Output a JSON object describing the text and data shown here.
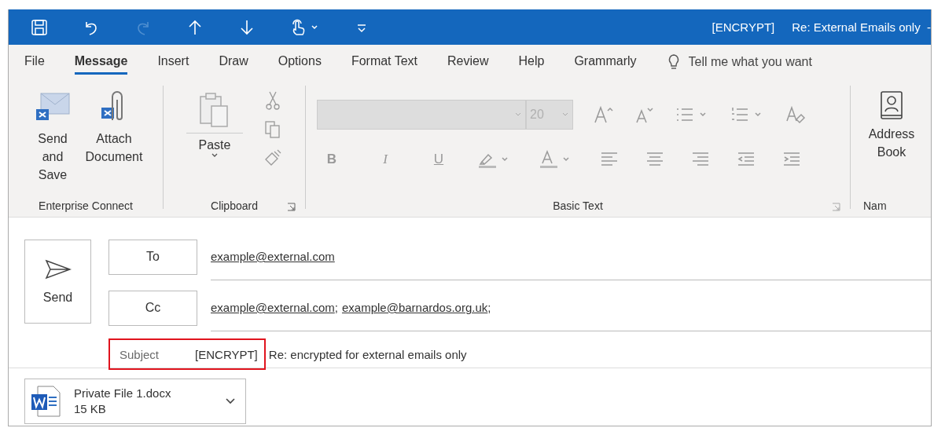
{
  "quick_access": [
    {
      "kind": "save",
      "disabled": false
    },
    {
      "kind": "undo",
      "disabled": false
    },
    {
      "kind": "redo",
      "disabled": true
    },
    {
      "kind": "up",
      "disabled": false
    },
    {
      "kind": "down",
      "disabled": false
    },
    {
      "kind": "touch",
      "disabled": false
    },
    {
      "kind": "customize",
      "disabled": false
    }
  ],
  "window": {
    "tag": "[ENCRYPT]",
    "title": "Re: External Emails only  -"
  },
  "tabs": [
    {
      "label": "File",
      "selected": false
    },
    {
      "label": "Message",
      "selected": true
    },
    {
      "label": "Insert",
      "selected": false
    },
    {
      "label": "Draw",
      "selected": false
    },
    {
      "label": "Options",
      "selected": false
    },
    {
      "label": "Format Text",
      "selected": false
    },
    {
      "label": "Review",
      "selected": false
    },
    {
      "label": "Help",
      "selected": false
    },
    {
      "label": "Grammarly",
      "selected": false
    }
  ],
  "tell_me": {
    "placeholder": "Tell me what you want"
  },
  "ribbon": {
    "enterprise_connect": {
      "label": "Enterprise Connect",
      "buttons": [
        {
          "kind": "send-save",
          "label": "Send and Save"
        },
        {
          "kind": "attach",
          "label": "Attach Document"
        }
      ]
    },
    "clipboard": {
      "label": "Clipboard",
      "paste": "Paste"
    },
    "basic_text": {
      "label": "Basic Text",
      "font_size": "20",
      "disabled": true,
      "bold": "B",
      "italic": "I",
      "underline": "U"
    },
    "names": {
      "label": "Nam",
      "address_book": "Address Book"
    }
  },
  "compose": {
    "send": "Send",
    "to": {
      "button": "To",
      "recipients": [
        {
          "address": "example@external.com"
        }
      ]
    },
    "cc": {
      "button": "Cc",
      "recipients": [
        {
          "address": "example@external.com",
          "trailing": ";"
        },
        {
          "address": "example@barnardos.org.uk",
          "trailing": ";"
        }
      ]
    },
    "subject": {
      "label": "Subject",
      "tag": "[ENCRYPT]",
      "text": "Re: encrypted for external emails only",
      "highlighted": true
    },
    "attachment": {
      "name": "Private File 1.docx",
      "size": "15 KB"
    }
  }
}
